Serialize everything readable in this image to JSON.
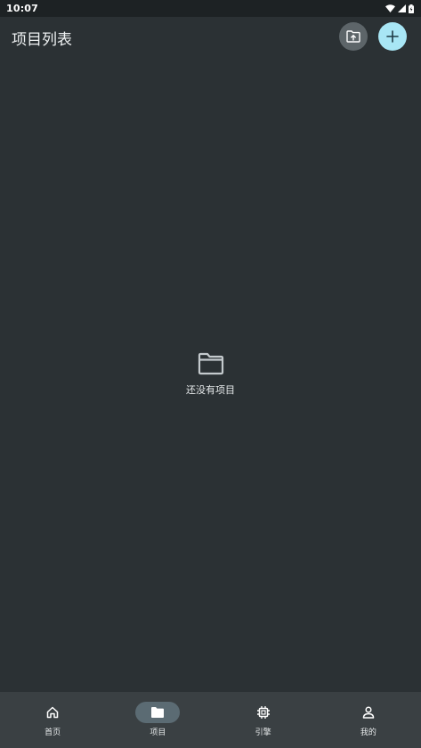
{
  "status_bar": {
    "time": "10:07"
  },
  "header": {
    "title": "项目列表"
  },
  "empty_state": {
    "message": "还没有项目"
  },
  "bottom_nav": {
    "items": [
      {
        "label": "首页",
        "icon": "home-icon"
      },
      {
        "label": "项目",
        "icon": "folder-icon",
        "active": true
      },
      {
        "label": "引擎",
        "icon": "chip-icon"
      },
      {
        "label": "我的",
        "icon": "person-icon"
      }
    ]
  },
  "colors": {
    "background": "#2b3134",
    "status_bar": "#1d2224",
    "nav_bar": "#3a4043",
    "active_pill": "#5b6b73",
    "add_button": "#a8e6f5",
    "import_button": "#5d6569"
  }
}
